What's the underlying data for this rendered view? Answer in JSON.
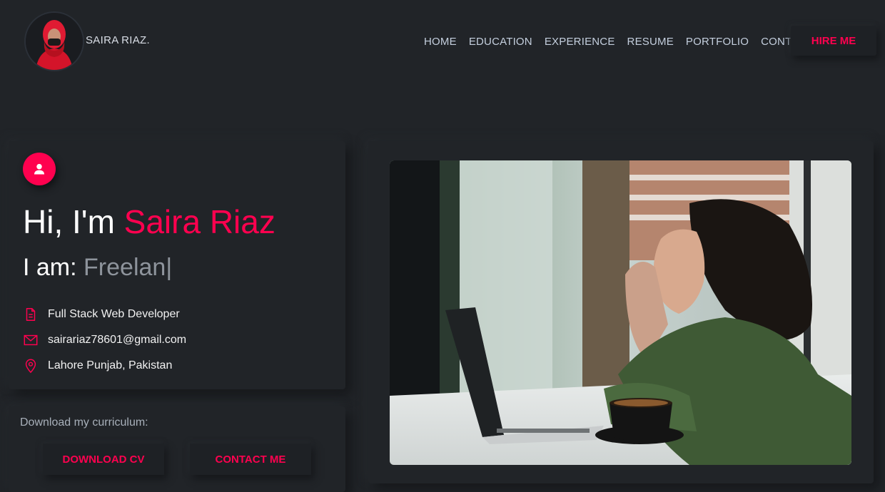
{
  "header": {
    "brand": "SAIRA RIAZ.",
    "nav": [
      "HOME",
      "EDUCATION",
      "EXPERIENCE",
      "RESUME",
      "PORTFOLIO",
      "CONTACT"
    ],
    "hire_label": "HIRE ME"
  },
  "intro": {
    "greeting_prefix": "Hi, I'm ",
    "name": "Saira Riaz",
    "iam_prefix": "I am: ",
    "typed": "Freelan",
    "cursor": "|",
    "info": [
      {
        "icon": "document-icon",
        "text": "Full Stack Web Developer"
      },
      {
        "icon": "mail-icon",
        "text": "sairariaz78601@gmail.com"
      },
      {
        "icon": "location-pin-icon",
        "text": "Lahore Punjab, Pakistan"
      }
    ]
  },
  "download": {
    "label": "Download my curriculum:",
    "cv_label": "DOWNLOAD CV",
    "contact_label": "CONTACT ME"
  },
  "colors": {
    "background": "#212428",
    "accent": "#ff014f",
    "text": "#c4cfde"
  }
}
